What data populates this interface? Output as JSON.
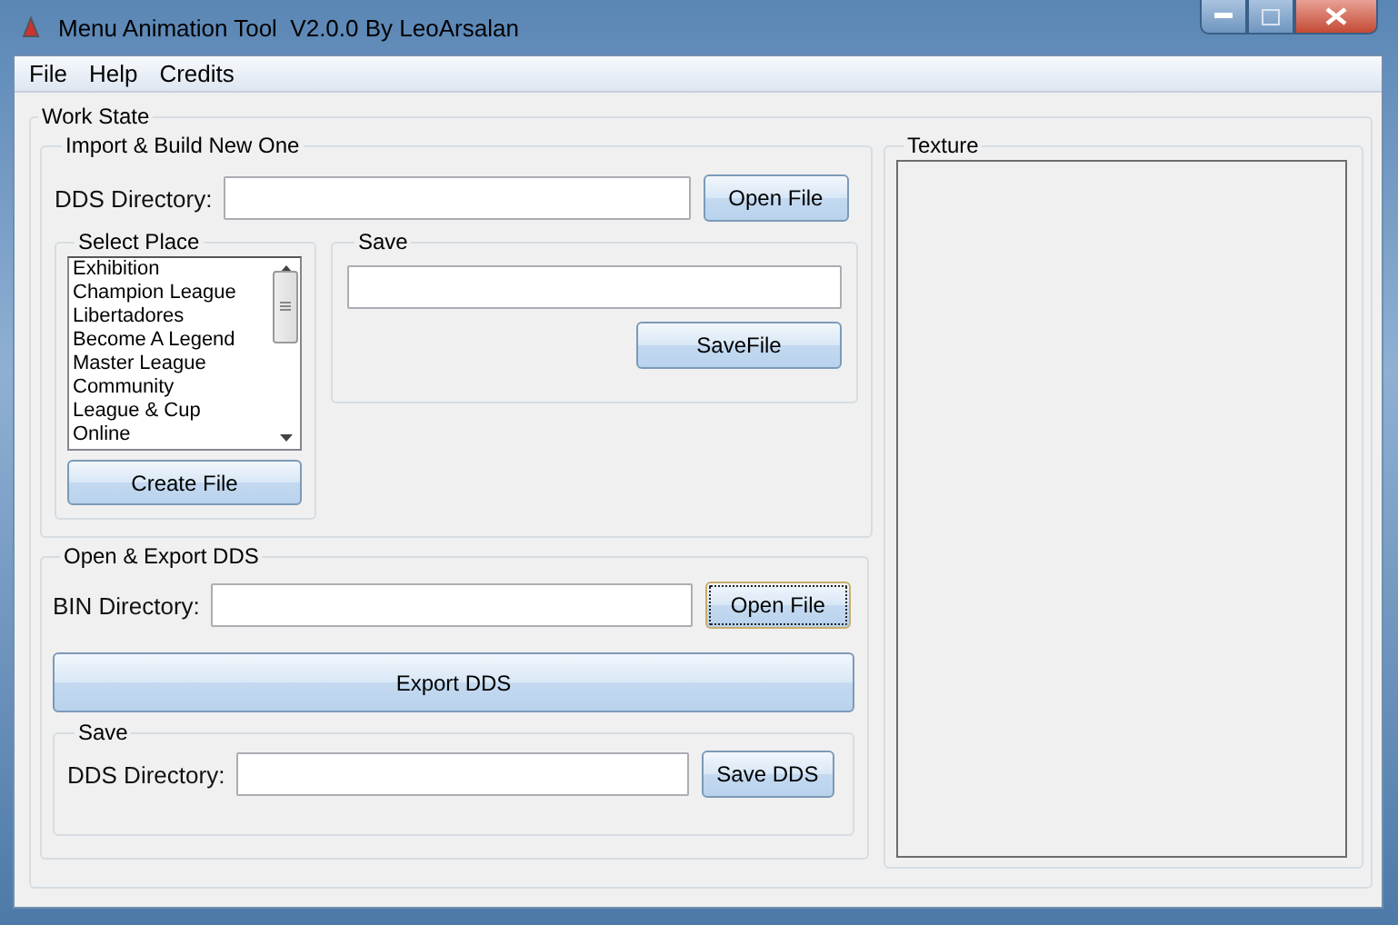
{
  "window": {
    "title": "Menu Animation Tool  V2.0.0 By LeoArsalan"
  },
  "menu": [
    "File",
    "Help",
    "Credits"
  ],
  "work_state": {
    "title": "Work State",
    "import_group": {
      "title": "Import & Build New One",
      "dds_label": "DDS Directory:",
      "open_button": {
        "label": "Open File",
        "focused": false
      },
      "select_place": {
        "title": "Select Place",
        "items": [
          {
            "label": "Exhibition",
            "selected": false
          },
          {
            "label": "Champion League",
            "selected": false
          },
          {
            "label": "Libertadores",
            "selected": false
          },
          {
            "label": "Become A Legend",
            "selected": false
          },
          {
            "label": "Master League",
            "selected": false
          },
          {
            "label": "Community",
            "selected": false
          },
          {
            "label": "League & Cup",
            "selected": false
          },
          {
            "label": "Online",
            "selected": false
          }
        ],
        "button": "Create File"
      },
      "save": {
        "title": "Save",
        "button": "SaveFile"
      }
    },
    "export_group": {
      "title": "Open & Export DDS",
      "bin_label": "BIN Directory:",
      "open_button": {
        "label": "Open File",
        "focused": true
      },
      "export_button": "Export DDS",
      "save": {
        "title": "Save",
        "dds_label": "DDS Directory:",
        "button": "Save DDS"
      }
    },
    "texture": {
      "title": "Texture"
    }
  }
}
